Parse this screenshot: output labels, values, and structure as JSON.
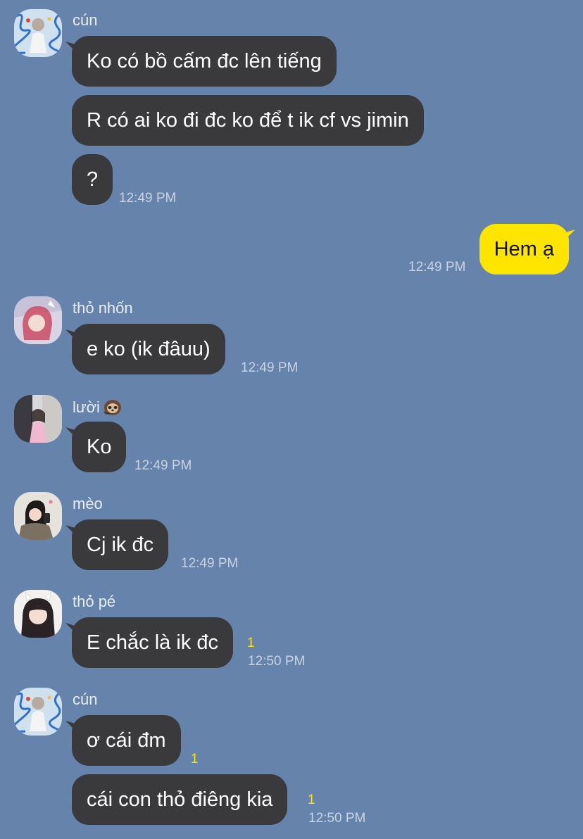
{
  "theme": {
    "background": "#6583ab",
    "incoming_bubble": "#3a3a3c",
    "outgoing_bubble": "#fee500",
    "unread_color": "#fee500"
  },
  "messages": {
    "group1": {
      "sender": "cún",
      "texts": [
        "Ko có bồ cấm đc lên tiếng",
        "R có ai ko đi đc ko để t ik cf vs jimin",
        "?"
      ],
      "time": "12:49 PM"
    },
    "mine": {
      "text": "Hem ạ",
      "time": "12:49 PM"
    },
    "group2": {
      "sender": "thỏ nhốn",
      "text": "e ko (ik đâuu)",
      "time": "12:49 PM"
    },
    "group3": {
      "sender": "lười",
      "sender_emoji": "sloth-icon",
      "text": "Ko",
      "time": "12:49 PM"
    },
    "group4": {
      "sender": "mèo",
      "text": "Cj ik đc",
      "time": "12:49 PM"
    },
    "group5": {
      "sender": "thỏ pé",
      "text": "E chắc là ik đc",
      "unread": "1",
      "time": "12:50 PM"
    },
    "group6": {
      "sender": "cún",
      "texts": [
        "ơ cái đm",
        "cái con thỏ điêng kia"
      ],
      "unread": [
        "1",
        "1"
      ],
      "time": "12:50 PM"
    }
  }
}
